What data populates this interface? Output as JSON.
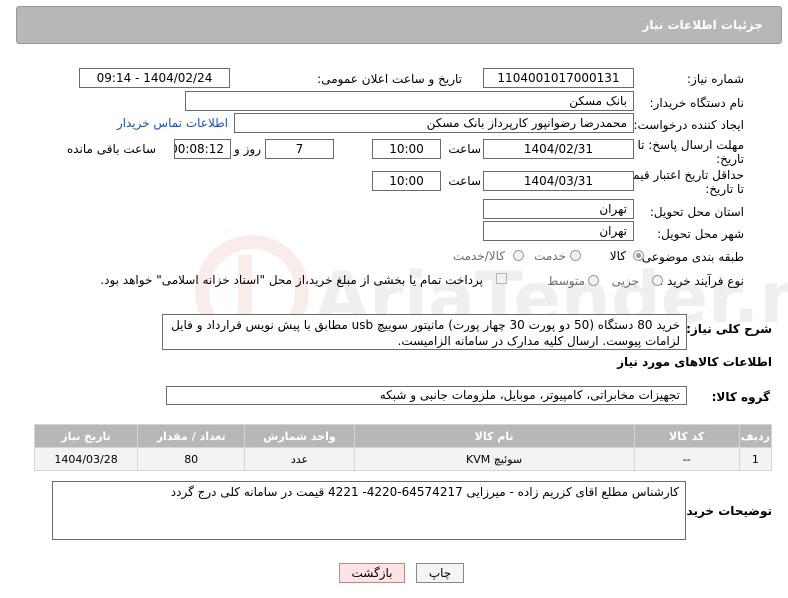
{
  "header": {
    "title": "جزئیات اطلاعات نیاز"
  },
  "form": {
    "need_number_label": "شماره نیاز:",
    "need_number": "1104001017000131",
    "announce_label": "تاریخ و ساعت اعلان عمومی:",
    "announce_value": "1404/02/24 - 09:14",
    "buyer_org_label": "نام دستگاه خریدار:",
    "buyer_org": "بانک مسکن",
    "creator_label": "ایجاد کننده درخواست:",
    "creator": "محمدرضا رضوانپور کارپرداز بانک مسکن",
    "contact_link": "اطلاعات تماس خریدار",
    "reply_deadline_label_1": "مهلت ارسال پاسخ: تا",
    "reply_deadline_label_2": "تاریخ:",
    "reply_date": "1404/02/31",
    "time_word": "ساعت",
    "reply_time": "10:00",
    "days_value": "7",
    "days_and": "روز و",
    "remaining_time": "00:08:12",
    "remaining_label": "ساعت باقی مانده",
    "price_validity_label_1": "حداقل تاریخ اعتبار قیمت:",
    "price_validity_label_2": "تا تاریخ:",
    "price_date": "1404/03/31",
    "price_time": "10:00",
    "province_label": "استان محل تحویل:",
    "province": "تهران",
    "city_label": "شهر محل تحویل:",
    "city": "تهران",
    "category_label": "طبقه بندی موضوعی:",
    "category_options": [
      "کالا",
      "خدمت",
      "کالا/خدمت"
    ],
    "process_label": "نوع فرآیند خرید :",
    "process_options": [
      "جزیی",
      "متوسط"
    ],
    "payment_note": "پرداخت تمام یا بخشی از مبلغ خرید،از محل \"اسناد خزانه اسلامی\" خواهد بود."
  },
  "description": {
    "label": "شرح کلی نیاز:",
    "text": "خرید 80 دستگاه (50 دو پورت 30 چهار پورت) مانیتور سوییچ usb مطابق با پیش نویس قرارداد و فایل لزامات پیوست. ارسال کلیه مدارک در سامانه الزامیست."
  },
  "goods_section": {
    "title": "اطلاعات کالاهای مورد نیاز",
    "group_label": "گروه کالا:",
    "group_value": "تجهیزات مخابراتی، کامپیوتر، موبایل، ملزومات جانبی و شبکه",
    "columns": [
      "ردیف",
      "کد کالا",
      "نام کالا",
      "واحد شمارش",
      "تعداد / مقدار",
      "تاریخ نیاز"
    ],
    "rows": [
      {
        "row": "1",
        "code": "--",
        "name": "سوئیچ KVM",
        "unit": "عدد",
        "qty": "80",
        "date": "1404/03/28"
      }
    ]
  },
  "buyer_notes": {
    "label": "توضیحات خریدار:",
    "text": "کارشناس مطلع اقای کزریم زاده - میرزایی 64574217-4220- 4221  قیمت در سامانه کلی درج گردد"
  },
  "buttons": {
    "print": "چاپ",
    "back": "بازگشت"
  },
  "watermark": {
    "text": "AriaTender.neT"
  }
}
